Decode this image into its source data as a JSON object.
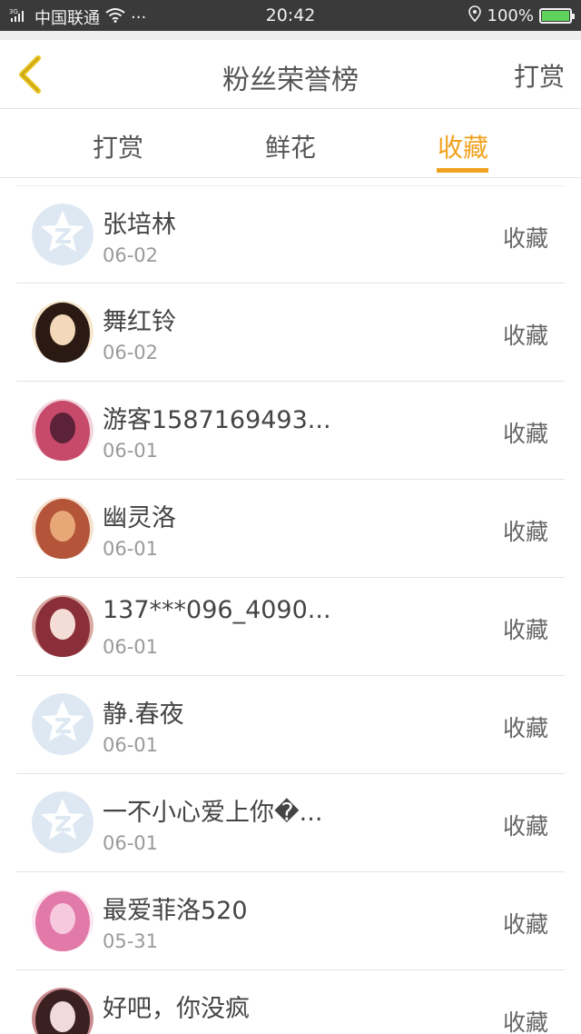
{
  "status_bar": {
    "carrier": "中国联通",
    "network": "3G",
    "dots": "···",
    "time": "20:42",
    "battery": "100%",
    "battery_level": 1.0
  },
  "header": {
    "title": "粉丝荣誉榜",
    "action_label": "打赏"
  },
  "tabs": [
    {
      "label": "打赏",
      "active": false
    },
    {
      "label": "鲜花",
      "active": false
    },
    {
      "label": "收藏",
      "active": true
    }
  ],
  "colors": {
    "accent": "#f0a21f",
    "back_arrow": "#e8c21e"
  },
  "list": [
    {
      "name": "张培林",
      "date": "06-02",
      "action": "收藏",
      "avatar": "default-avatar"
    },
    {
      "name": "舞红铃",
      "date": "06-02",
      "action": "收藏",
      "avatar": "user-avatar"
    },
    {
      "name": "游客1587169493...",
      "date": "06-01",
      "action": "收藏",
      "avatar": "user-avatar"
    },
    {
      "name": "幽灵洛",
      "date": "06-01",
      "action": "收藏",
      "avatar": "user-avatar"
    },
    {
      "name": "137***096_4090...",
      "date": "06-01",
      "action": "收藏",
      "avatar": "user-avatar"
    },
    {
      "name": "静.春夜",
      "date": "06-01",
      "action": "收藏",
      "avatar": "default-avatar"
    },
    {
      "name": "一不小心爱上你�...",
      "date": "06-01",
      "action": "收藏",
      "avatar": "default-avatar"
    },
    {
      "name": "最爱菲洛520",
      "date": "05-31",
      "action": "收藏",
      "avatar": "user-avatar"
    },
    {
      "name": "好吧，你没疯",
      "date": "",
      "action": "收藏",
      "avatar": "user-avatar"
    }
  ]
}
